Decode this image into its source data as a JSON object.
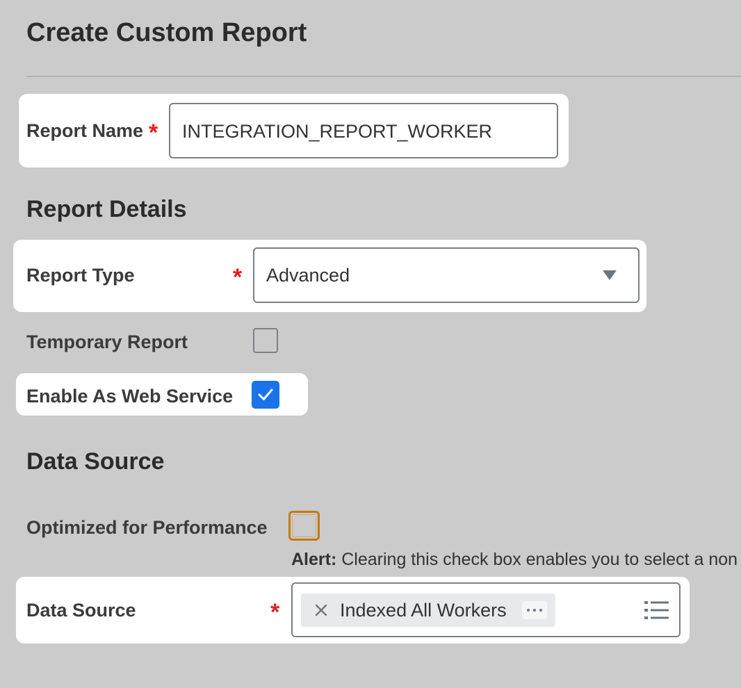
{
  "page": {
    "title": "Create Custom Report"
  },
  "report_name": {
    "label": "Report Name",
    "required_mark": "*",
    "value": "INTEGRATION_REPORT_WORKER"
  },
  "report_details": {
    "heading": "Report Details",
    "report_type": {
      "label": "Report Type",
      "required_mark": "*",
      "selected": "Advanced"
    },
    "temporary_report": {
      "label": "Temporary Report",
      "checked": false
    },
    "enable_web_service": {
      "label": "Enable As Web Service",
      "checked": true
    }
  },
  "data_source_section": {
    "heading": "Data Source",
    "optimized": {
      "label": "Optimized for Performance",
      "checked": false
    },
    "alert": {
      "prefix": "Alert:",
      "text": "Clearing this check box enables you to select a non"
    },
    "data_source": {
      "label": "Data Source",
      "required_mark": "*",
      "selected_item": "Indexed All Workers"
    }
  },
  "colors": {
    "background": "#cbcbcb",
    "required": "#e02020",
    "checkbox_checked": "#1a73e8",
    "focus_outline": "#c07a1a"
  }
}
